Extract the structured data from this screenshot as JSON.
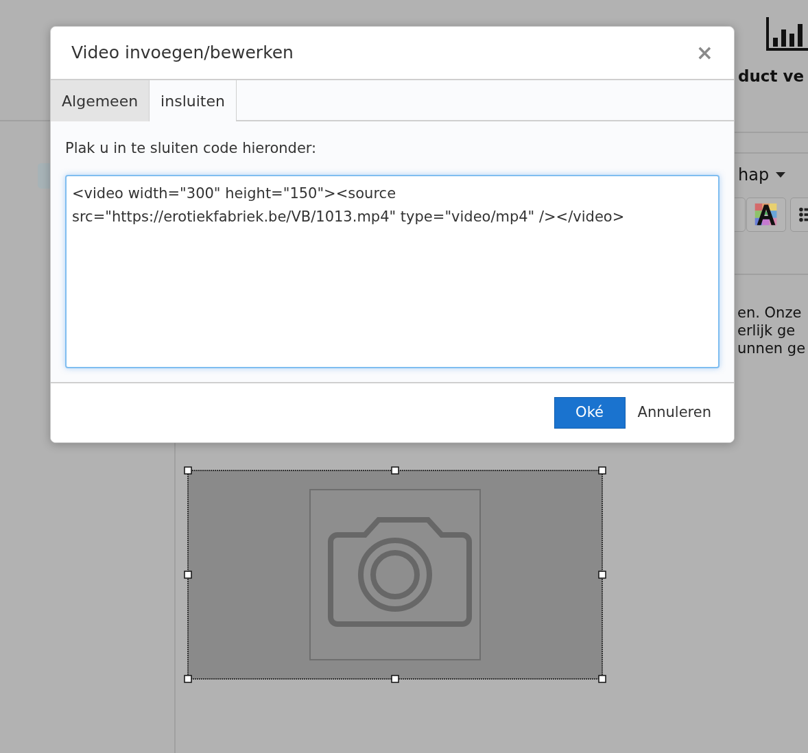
{
  "background": {
    "toolbar_label": "duct ve",
    "dropdown": "hap",
    "paragraph_lines": [
      "en. Onze",
      "erlijk ge",
      "unnen ge"
    ]
  },
  "dialog": {
    "title": "Video invoegen/bewerken",
    "close": "×",
    "tabs": [
      {
        "label": "Algemeen",
        "selected": false
      },
      {
        "label": "insluiten",
        "selected": true
      }
    ],
    "prompt": "Plak u in te sluiten code hieronder:",
    "code": "<video width=\"300\" height=\"150\"><source src=\"https://erotiekfabriek.be/VB/1013.mp4\" type=\"video/mp4\" /></video>",
    "buttons": [
      {
        "label": "Oké",
        "kind": "primary"
      },
      {
        "label": "Annuleren",
        "kind": "plain"
      }
    ]
  }
}
